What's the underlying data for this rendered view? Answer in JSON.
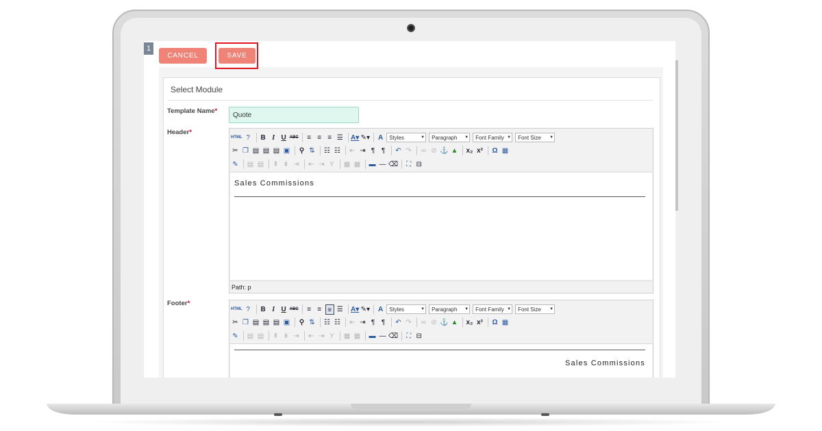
{
  "buttons": {
    "cancel_label": "CANCEL",
    "save_label": "SAVE"
  },
  "side_tab_label": "1",
  "panel_title": "Select Module",
  "fields": {
    "template_name_label": "Template Name",
    "template_name_value": "Quote",
    "header_label": "Header",
    "footer_label": "Footer",
    "required_mark": "*"
  },
  "toolbar": {
    "styles": "Styles",
    "paragraph": "Paragraph",
    "font_family": "Font Family",
    "font_size": "Font Size"
  },
  "header_editor": {
    "content": "Sales Commissions",
    "status": "Path: p"
  },
  "footer_editor": {
    "content": "Sales Commissions"
  },
  "colors": {
    "button": "#f08377",
    "highlight": "#e0141e",
    "input_bg": "#dff7ee"
  }
}
